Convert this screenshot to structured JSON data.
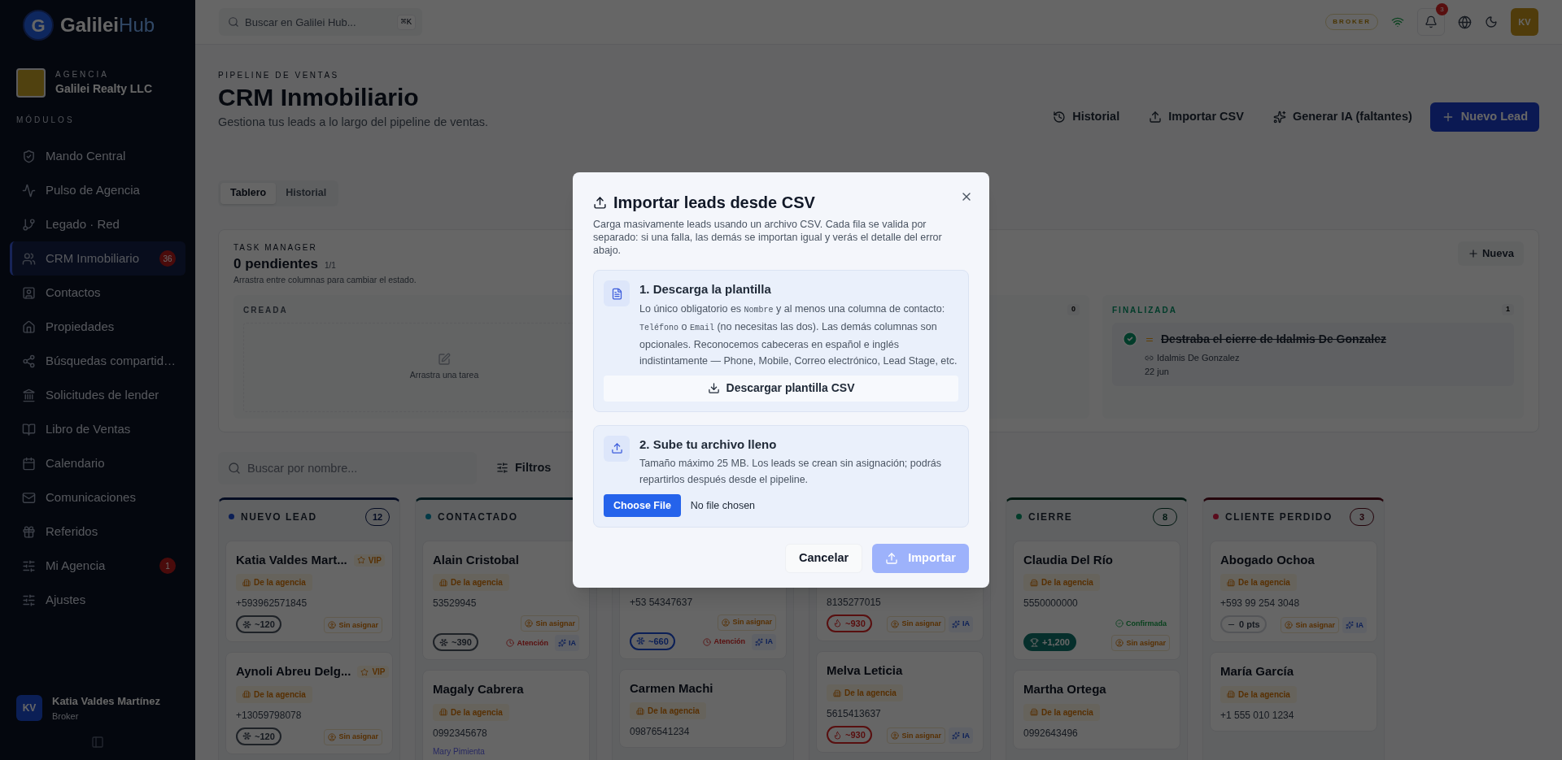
{
  "logo": {
    "mark": "G",
    "name": "Galilei",
    "suffix": "Hub"
  },
  "agency": {
    "label": "AGENCIA",
    "name": "Galilei Realty LLC"
  },
  "sidebar": {
    "section": "MÓDULOS",
    "items": [
      {
        "label": "Mando Central",
        "selected": false
      },
      {
        "label": "Pulso de Agencia",
        "selected": false
      },
      {
        "label": "Legado · Red",
        "selected": false
      },
      {
        "label": "CRM Inmobiliario",
        "selected": true,
        "badge": "36"
      },
      {
        "label": "Contactos",
        "selected": false
      },
      {
        "label": "Propiedades",
        "selected": false
      },
      {
        "label": "Búsquedas compartid…",
        "selected": false
      },
      {
        "label": "Solicitudes de lender",
        "selected": false
      },
      {
        "label": "Libro de Ventas",
        "selected": false
      },
      {
        "label": "Calendario",
        "selected": false
      },
      {
        "label": "Comunicaciones",
        "selected": false
      },
      {
        "label": "Referidos",
        "selected": false
      },
      {
        "label": "Mi Agencia",
        "selected": false,
        "badge": "1"
      },
      {
        "label": "Ajustes",
        "selected": false
      }
    ],
    "user": {
      "initials": "KV",
      "name": "Katia Valdes Martínez",
      "role": "Broker"
    }
  },
  "topbar": {
    "search": {
      "placeholder": "Buscar en Galilei Hub...",
      "shortcut": "⌘K"
    },
    "role_badge": "BROKER",
    "notifications": "3",
    "avatar": "KV"
  },
  "header": {
    "eyebrow": "PIPELINE DE VENTAS",
    "title": "CRM Inmobiliario",
    "subtitle": "Gestiona tus leads a lo largo del pipeline de ventas.",
    "actions": [
      {
        "label": "Historial",
        "kind": "history"
      },
      {
        "label": "Importar CSV",
        "kind": "import"
      },
      {
        "label": "Generar IA (faltantes)",
        "kind": "ai"
      },
      {
        "label": "Nuevo Lead",
        "kind": "primary"
      }
    ]
  },
  "tabs": [
    {
      "label": "Tablero",
      "selected": true
    },
    {
      "label": "Historial",
      "selected": false
    }
  ],
  "task_manager": {
    "label": "TASK MANAGER",
    "title": "0 pendientes",
    "count": "1/1",
    "hint": "Arrastra entre columnas para cambiar el estado.",
    "new_button": "Nueva",
    "columns": [
      {
        "title": "CREADA",
        "empty": "Arrastra una tarea"
      },
      {
        "count": "0"
      },
      {
        "title": "FINALIZADA",
        "count": "1",
        "tasks": [
          {
            "title": "Destraba el cierre de Idalmis De Gonzalez",
            "done": true,
            "contact": "Idalmis De Gonzalez",
            "date": "22 jun"
          }
        ]
      }
    ]
  },
  "filters": {
    "search_placeholder": "Buscar por nombre...",
    "filter_button": "Filtros"
  },
  "kanban": {
    "columns": [
      {
        "title": "NUEVO LEAD",
        "count": "12",
        "color": "#0c1f56",
        "cards": [
          {
            "name": "Katia Valdes Mart...",
            "vip": "VIP",
            "tag": "De la agencia",
            "phone": "+593962571845",
            "points": {
              "text": "~120",
              "kind": "cold"
            },
            "badges": [
              {
                "text": "Sin asignar",
                "kind": "unassigned"
              }
            ]
          },
          {
            "name": "Aynoli Abreu Delg...",
            "vip": "VIP",
            "tag": "De la agencia",
            "phone": "+13059798078",
            "points": {
              "text": "~120",
              "kind": "cold"
            },
            "badges": [
              {
                "text": "Sin asignar",
                "kind": "unassigned"
              }
            ]
          }
        ]
      },
      {
        "title": "CONTACTADO",
        "color": "#033a47",
        "cards": [
          {
            "name": "Alain Cristobal",
            "tag": "De la agencia",
            "phone": "53529945",
            "points": {
              "text": "~390",
              "kind": "cold"
            },
            "badges": [
              {
                "text": "Sin asignar",
                "kind": "unassigned"
              },
              {
                "text": "Atención",
                "kind": "attention"
              },
              {
                "text": "IA",
                "kind": "ai"
              }
            ]
          },
          {
            "name": "Magaly Cabrera",
            "tag": "De la agencia",
            "phone": "0992345678",
            "agent": "Mary Pimienta"
          }
        ]
      },
      {
        "cards": [
          {
            "phone": "+53 54347637",
            "points": {
              "text": "~660",
              "kind": "cool"
            },
            "badges": [
              {
                "text": "Sin asignar",
                "kind": "unassigned"
              },
              {
                "text": "Atención",
                "kind": "attention"
              },
              {
                "text": "IA",
                "kind": "ai"
              }
            ]
          },
          {
            "name": "Carmen Machi",
            "tag": "De la agencia",
            "phone": "09876541234"
          }
        ]
      },
      {
        "cards": [
          {
            "phone": "8135277015",
            "points": {
              "text": "~930",
              "kind": "hot"
            },
            "badges": [
              {
                "text": "Sin asignar",
                "kind": "unassigned"
              },
              {
                "text": "IA",
                "kind": "ai"
              }
            ]
          },
          {
            "name": "Melva Leticia",
            "tag": "De la agencia",
            "phone": "5615413637",
            "points": {
              "text": "~930",
              "kind": "hot"
            },
            "badges": [
              {
                "text": "Sin asignar",
                "kind": "unassigned"
              },
              {
                "text": "IA",
                "kind": "ai"
              }
            ]
          }
        ]
      },
      {
        "title": "CIERRE",
        "count": "8",
        "color": "#023c2a",
        "cards": [
          {
            "name": "Claudia Del Río",
            "tag": "De la agencia",
            "phone": "5550000000",
            "points": {
              "text": "+1,200",
              "kind": "won"
            },
            "badges": [
              {
                "text": "Confirmada",
                "kind": "confirmed"
              },
              {
                "text": "Sin asignar",
                "kind": "unassigned"
              }
            ]
          },
          {
            "name": "Martha Ortega",
            "tag": "De la agencia",
            "phone": "0992643496"
          }
        ]
      },
      {
        "title": "CLIENTE PERDIDO",
        "count": "3",
        "color": "#5a0c1d",
        "cards": [
          {
            "name": "Abogado Ochoa",
            "tag": "De la agencia",
            "phone": "+593 99 254 3048",
            "points": {
              "text": "0 pts",
              "kind": "none"
            },
            "badges": [
              {
                "text": "Sin asignar",
                "kind": "unassigned"
              },
              {
                "text": "IA",
                "kind": "ai"
              }
            ]
          },
          {
            "name": "María García",
            "tag": "De la agencia",
            "phone": "+1 555 010 1234"
          }
        ]
      }
    ]
  },
  "modal": {
    "title": "Importar leads desde CSV",
    "description": "Carga masivamente leads usando un archivo CSV. Cada fila se valida por separado: si una falla, las demás se importan igual y verás el detalle del error abajo.",
    "steps": [
      {
        "title": "1. Descarga la plantilla",
        "kind": "download",
        "parts": [
          {
            "text": "Lo único obligatorio es ",
            "kind": "plain"
          },
          {
            "text": "Nombre",
            "kind": "code"
          },
          {
            "text": " y al menos una columna de contacto: ",
            "kind": "plain"
          },
          {
            "text": "Teléfono",
            "kind": "code"
          },
          {
            "text": " o ",
            "kind": "plain"
          },
          {
            "text": "Email",
            "kind": "code"
          },
          {
            "text": " (no necesitas las dos). Las demás columnas son opcionales. Reconocemos cabeceras en español e inglés indistintamente — Phone, Mobile, Correo electrónico, Lead Stage, etc.",
            "kind": "plain"
          }
        ],
        "button": "Descargar plantilla CSV"
      },
      {
        "title": "2. Sube tu archivo lleno",
        "kind": "upload",
        "parts": [
          {
            "text": "Tamaño máximo 25 MB. Los leads se crean sin asignación; podrás repartirlos después desde el pipeline.",
            "kind": "plain"
          }
        ],
        "file_button": "Choose File",
        "file_status": "No file chosen"
      }
    ],
    "buttons": [
      {
        "label": "Cancelar",
        "kind": "secondary",
        "disabled": false
      },
      {
        "label": "Importar",
        "kind": "primary",
        "disabled": true
      }
    ]
  }
}
